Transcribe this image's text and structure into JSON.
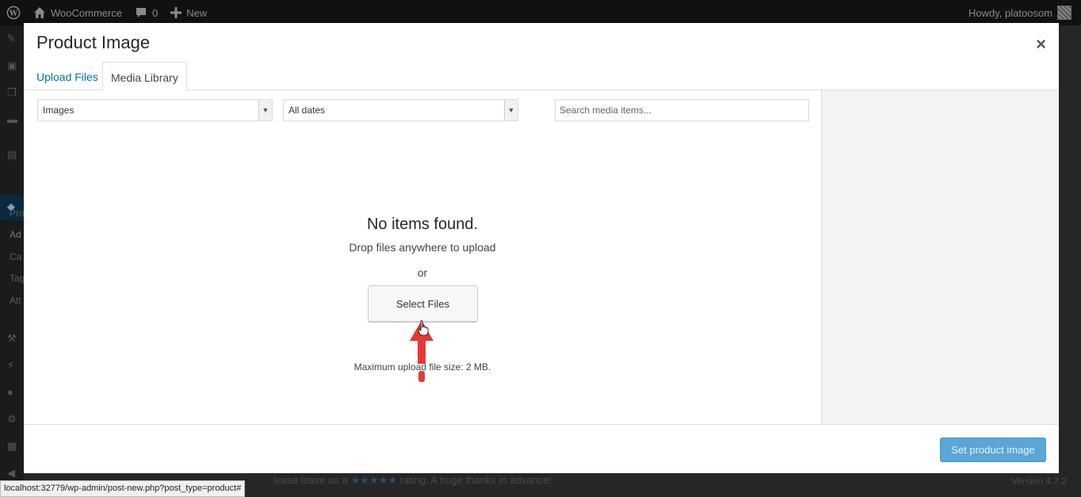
{
  "adminbar": {
    "site_name": "WooCommerce",
    "comments_count": "0",
    "new_label": "New",
    "howdy": "Howdy, platoosom"
  },
  "sidebar": {
    "items": [
      "Pro",
      "Ad",
      "Ca",
      "Tag",
      "Att"
    ]
  },
  "footer": {
    "left_text": "lease leave us a",
    "stars": "★★★★★",
    "left_text_end": "rating. A huge thanks in advance!",
    "version": "Version 4.7.2"
  },
  "statusbar": {
    "url": "localhost:32779/wp-admin/post-new.php?post_type=product#"
  },
  "modal": {
    "title": "Product Image",
    "close_glyph": "×",
    "tabs": [
      {
        "label": "Upload Files"
      },
      {
        "label": "Media Library"
      }
    ],
    "filters": {
      "type_value": "Images",
      "date_value": "All dates",
      "search_placeholder": "Search media items..."
    },
    "empty": {
      "title": "No items found.",
      "drop": "Drop files anywhere to upload",
      "or": "or",
      "select_button": "Select Files",
      "max_size": "Maximum upload file size: 2 MB."
    },
    "set_button": "Set product image"
  },
  "colors": {
    "accent": "#0073aa",
    "primary_button": "#5aa6d6",
    "annotation_arrow": "#e53935"
  }
}
